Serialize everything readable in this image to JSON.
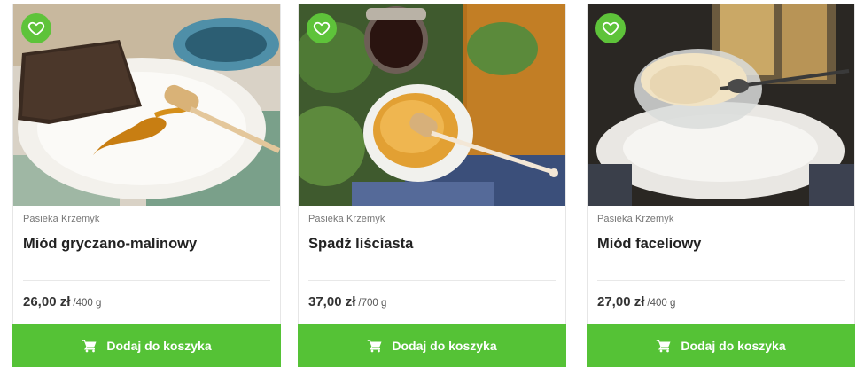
{
  "products": [
    {
      "producer": "Pasieka Krzemyk",
      "name": "Miód gryczano-malinowy",
      "price": "26,00 zł",
      "unit": "/400 g",
      "cart_label": "Dodaj do koszyka",
      "favorite_icon": "heart-outline-icon",
      "image": "dark-bread-slice-on-plate-with-honey-and-honey-dipper"
    },
    {
      "producer": "Pasieka Krzemyk",
      "name": "Spadź liściasta",
      "price": "37,00 zł",
      "unit": "/700 g",
      "cart_label": "Dodaj do koszyka",
      "favorite_icon": "heart-outline-icon",
      "image": "honey-saucer-with-dipper-jar-and-oak-leaves"
    },
    {
      "producer": "Pasieka Krzemyk",
      "name": "Miód faceliowy",
      "price": "27,00 zł",
      "unit": "/400 g",
      "cart_label": "Dodaj do koszyka",
      "favorite_icon": "heart-outline-icon",
      "image": "glass-bowl-of-creamed-honey-with-spoon"
    }
  ],
  "colors": {
    "accent_green": "#55c236",
    "favorite_green": "#5ec33a",
    "text_dark": "#222222",
    "text_muted": "#777777"
  }
}
